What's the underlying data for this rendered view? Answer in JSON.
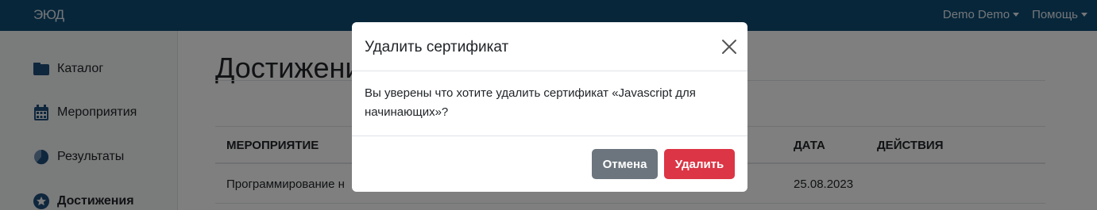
{
  "navbar": {
    "brand": "ЭЮД",
    "user_menu": "Demo Demo",
    "help_menu": "Помощь"
  },
  "sidebar": {
    "items": [
      {
        "label": "Каталог",
        "icon": "folder-icon"
      },
      {
        "label": "Мероприятия",
        "icon": "calendar-icon"
      },
      {
        "label": "Результаты",
        "icon": "pie-chart-icon"
      },
      {
        "label": "Достижения",
        "icon": "star-icon",
        "active": true
      }
    ]
  },
  "main": {
    "title": "Достижени",
    "table": {
      "headers": [
        "МЕРОПРИЯТИЕ",
        "ДАТА",
        "ДЕЙСТВИЯ"
      ],
      "rows": [
        {
          "event": "Программирование н",
          "date": "25.08.2023"
        }
      ]
    }
  },
  "modal": {
    "title": "Удалить сертификат",
    "body": "Вы уверены что хотите удалить сертификат «Javascript для начинающих»?",
    "cancel_label": "Отмена",
    "delete_label": "Удалить"
  },
  "colors": {
    "navbar": "#0f4c75",
    "cancel": "#6c757d",
    "danger": "#dc3545"
  }
}
